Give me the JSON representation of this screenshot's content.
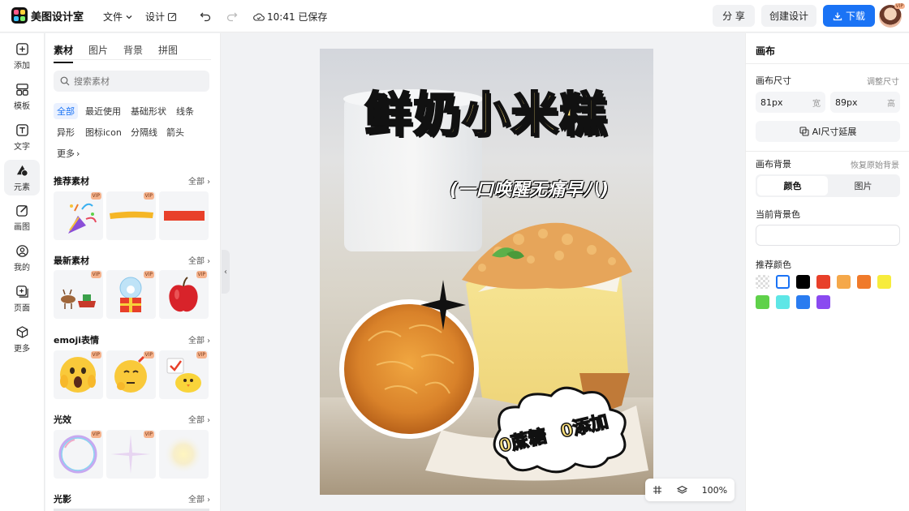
{
  "app": {
    "name": "美图设计室"
  },
  "topbar": {
    "file_menu": "文件",
    "design_menu": "设计",
    "save_status": "10:41 已保存",
    "share_label": "分 享",
    "create_label": "创建设计",
    "download_label": "下载",
    "avatar_badge": "VIP"
  },
  "rail": {
    "items": [
      {
        "label": "添加",
        "icon": "plus-square-icon"
      },
      {
        "label": "模板",
        "icon": "template-icon"
      },
      {
        "label": "文字",
        "icon": "text-icon"
      },
      {
        "label": "元素",
        "icon": "shapes-icon"
      },
      {
        "label": "画图",
        "icon": "draw-icon"
      },
      {
        "label": "我的",
        "icon": "user-icon"
      },
      {
        "label": "页面",
        "icon": "page-add-icon"
      },
      {
        "label": "更多",
        "icon": "cube-icon"
      }
    ],
    "active": "元素"
  },
  "panel": {
    "tabs": [
      "素材",
      "图片",
      "背景",
      "拼图"
    ],
    "active_tab": "素材",
    "search_placeholder": "搜索素材",
    "chips": [
      "全部",
      "最近使用",
      "基础形状",
      "线条",
      "异形",
      "图标icon",
      "分隔线",
      "箭头",
      "更多"
    ],
    "active_chip": "全部",
    "all_label": "全部",
    "vip_label": "VIP",
    "sections": [
      {
        "title": "推荐素材",
        "tiles": [
          "party-popper",
          "yellow-brush-stroke",
          "red-bar"
        ]
      },
      {
        "title": "最新素材",
        "tiles": [
          "reindeer-sleigh",
          "snow-globe-gift",
          "red-apple"
        ]
      },
      {
        "title": "emoji表情",
        "tiles": [
          "shocked-emoji",
          "thinking-emoji",
          "chick-emoji"
        ]
      },
      {
        "title": "光效",
        "tiles": [
          "bubble-ring",
          "star-sparkle",
          "glow-light"
        ]
      },
      {
        "title": "光影",
        "tiles": []
      }
    ]
  },
  "canvas": {
    "title": "鲜奶小米糕",
    "subtitle": "(一口唤醒无痛早八)",
    "cloud_line1": "0蔗糖",
    "cloud_line2": "0添加",
    "zoom": "100%"
  },
  "right_panel": {
    "title": "画布",
    "size_label": "画布尺寸",
    "size_link": "调整尺寸",
    "width_value": "81px",
    "width_unit": "宽",
    "height_value": "89px",
    "height_unit": "高",
    "ai_extend_label": "AI尺寸延展",
    "bg_label": "画布背景",
    "bg_reset": "恢复原始背景",
    "bg_tabs": [
      "颜色",
      "图片"
    ],
    "current_bg_label": "当前背景色",
    "recommend_label": "推荐颜色",
    "colors": [
      "transparent",
      "#ffffff",
      "#000000",
      "#e8402a",
      "#f5a84a",
      "#f07a2a",
      "#f7ec3c",
      "#5fd14a",
      "#5ee6e6",
      "#2a7cf0",
      "#8a4af0"
    ]
  }
}
